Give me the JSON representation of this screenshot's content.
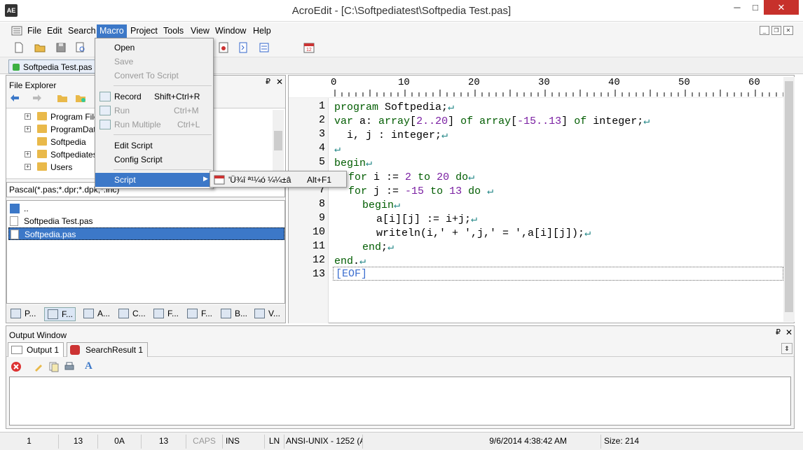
{
  "window": {
    "title": "AcroEdit - [C:\\Softpediatest\\Softpedia Test.pas]",
    "min_label": "─",
    "max_label": "□",
    "close_label": "✕"
  },
  "menu": {
    "items": [
      "File",
      "Edit",
      "Search",
      "Macro",
      "Project",
      "Tools",
      "View",
      "Window",
      "Help"
    ]
  },
  "file_tabs": [
    {
      "label": "Softpedia Test.pas"
    }
  ],
  "file_explorer": {
    "title": "File Explorer",
    "pin_label": "₽",
    "close_label": "✕",
    "tree": [
      "Program Files",
      "ProgramData",
      "Softpedia",
      "Softpediatest",
      "Users"
    ],
    "filter": "Pascal(*.pas;*.dpr;*.dpk;*.inc)",
    "files": [
      "..",
      "Softpedia Test.pas",
      "Softpedia.pas"
    ],
    "bottom_tabs": [
      "P...",
      "F...",
      "A...",
      "C...",
      "F...",
      "F...",
      "B...",
      "V..."
    ]
  },
  "macro_menu": {
    "open": "Open",
    "save": "Save",
    "convert": "Convert To Script",
    "record": "Record",
    "record_shortcut": "Shift+Ctrl+R",
    "run": "Run",
    "run_shortcut": "Ctrl+M",
    "run_multiple": "Run Multiple",
    "run_multiple_shortcut": "Ctrl+L",
    "edit_script": "Edit Script",
    "config_script": "Config Script",
    "script": "Script",
    "submenu_item": "'Ü¾î ª¹¼ó ¼¼±â",
    "submenu_shortcut": "Alt+F1"
  },
  "editor": {
    "ruler": [
      "0",
      "10",
      "20",
      "30",
      "40",
      "50",
      "60"
    ],
    "line_numbers": [
      "1",
      "2",
      "3",
      "4",
      "5",
      "6",
      "7",
      "8",
      "9",
      "10",
      "11",
      "12",
      "13"
    ],
    "lines": {
      "l1_kw": "program",
      "l1_rest": " Softpedia;",
      "l2_kw1": "var",
      "l2_a": " a: ",
      "l2_kw2": "array",
      "l2_b": "[",
      "l2_n1": "2..20",
      "l2_c": "] ",
      "l2_kw3": "of",
      "l2_d": " ",
      "l2_kw4": "array",
      "l2_e": "[",
      "l2_n2": "-15..13",
      "l2_f": "] ",
      "l2_kw5": "of",
      "l2_g": " integer;",
      "l3": "  i, j : integer;",
      "l5_kw": "begin",
      "l6_kw1": "for",
      "l6_a": " i := ",
      "l6_n1": "2",
      "l6_b": " ",
      "l6_kw2": "to",
      "l6_c": " ",
      "l6_n2": "20",
      "l6_d": " ",
      "l6_kw3": "do",
      "l7_kw1": "for",
      "l7_a": " j := ",
      "l7_n1": "-15",
      "l7_b": " ",
      "l7_kw2": "to",
      "l7_c": " ",
      "l7_n2": "13",
      "l7_d": " ",
      "l7_kw3": "do",
      "l8_kw": "begin",
      "l9": "a[i][j] := i+j;",
      "l10": "writeln(i,' + ',j,' = ',a[i][j]);",
      "l11_kw": "end",
      "l11_rest": ";",
      "l12_kw": "end",
      "l12_rest": ".",
      "eof": "[EOF]"
    },
    "return_mark": "↵"
  },
  "output": {
    "title": "Output Window",
    "tabs": [
      "Output 1",
      "SearchResult 1"
    ]
  },
  "status": {
    "col": "1",
    "line": "13",
    "hex": "0A",
    "char": "13",
    "caps": "CAPS",
    "ins": "INS",
    "ln": "LN",
    "encoding": "ANSI-UNIX - 1252  (A",
    "datetime": "9/6/2014 4:38:42 AM",
    "size": "Size: 214"
  },
  "colors": {
    "keyword": "#005c00",
    "number": "#7a1fa2",
    "menu_highlight": "#3c78c8",
    "close_button": "#c7312b"
  }
}
